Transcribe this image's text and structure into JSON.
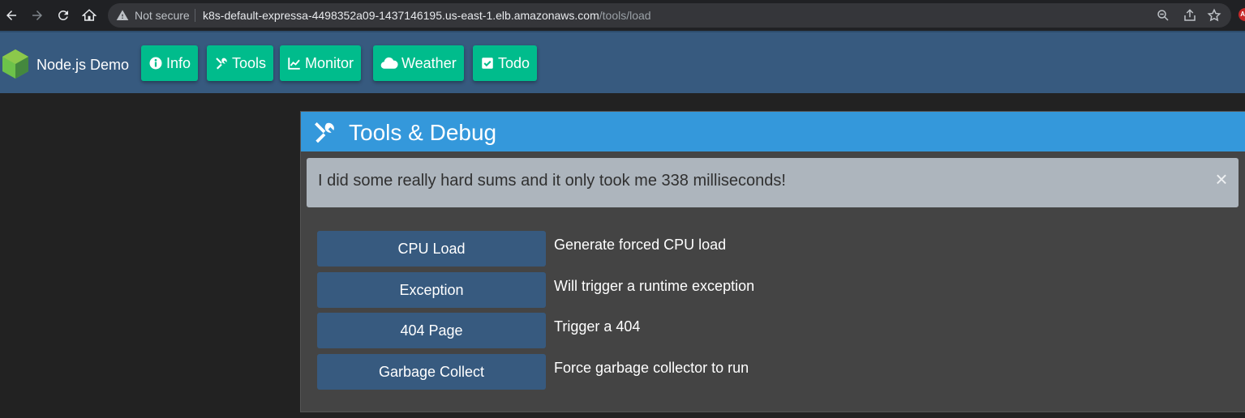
{
  "browser": {
    "security_label": "Not secure",
    "url_host": "k8s-default-expressa-4498352a09-1437146195.us-east-1.elb.amazonaws.com",
    "url_path": "/tools/load",
    "extension_badge": "AB"
  },
  "navbar": {
    "brand": "Node.js Demo",
    "items": [
      {
        "label": "Info",
        "icon": "info-circle-icon"
      },
      {
        "label": "Tools",
        "icon": "tools-icon"
      },
      {
        "label": "Monitor",
        "icon": "chart-icon"
      },
      {
        "label": "Weather",
        "icon": "cloud-icon"
      },
      {
        "label": "Todo",
        "icon": "check-square-icon"
      }
    ]
  },
  "card": {
    "title": "Tools & Debug",
    "alert": {
      "message": "I did some really hard sums and it only took me 338 milliseconds!",
      "close": "×"
    },
    "tools": [
      {
        "button": "CPU Load",
        "description": "Generate forced CPU load"
      },
      {
        "button": "Exception",
        "description": "Will trigger a runtime exception"
      },
      {
        "button": "404 Page",
        "description": "Trigger a 404"
      },
      {
        "button": "Garbage Collect",
        "description": "Force garbage collector to run"
      }
    ]
  },
  "colors": {
    "navbar_bg": "#375a7f",
    "nav_pill": "#00bc8c",
    "card_header": "#3498db",
    "card_body": "#444444",
    "alert_bg": "#adb5bd"
  }
}
